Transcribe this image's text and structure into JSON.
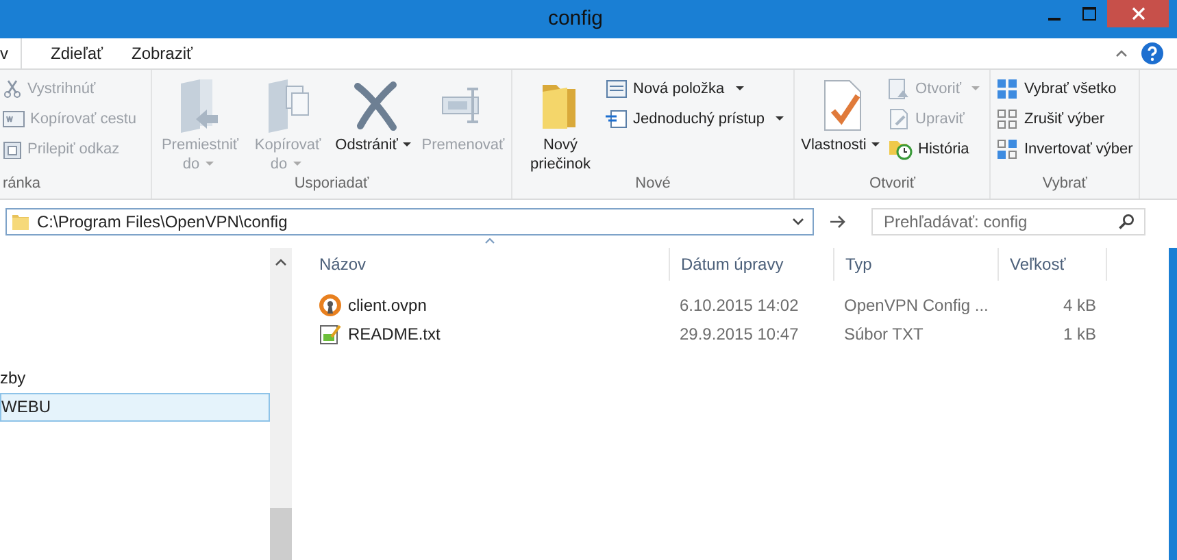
{
  "window": {
    "title": "config"
  },
  "tabs": [
    {
      "label": "v",
      "selected": true
    },
    {
      "label": "Zdieľať",
      "selected": false
    },
    {
      "label": "Zobraziť",
      "selected": false
    }
  ],
  "ribbon": {
    "groups": [
      {
        "label": "ránka",
        "items": [
          {
            "kind": "small",
            "label": "Vystrihnúť",
            "disabled": true,
            "dropdown": false
          },
          {
            "kind": "small",
            "label": "Kopírovať cestu",
            "disabled": true,
            "dropdown": false
          },
          {
            "kind": "small",
            "label": "Prilepiť odkaz",
            "disabled": true,
            "dropdown": false
          }
        ]
      },
      {
        "label": "Usporiadať",
        "items": [
          {
            "kind": "large",
            "label": "Premiestniť do",
            "disabled": true,
            "dropdown": true
          },
          {
            "kind": "large",
            "label": "Kopírovať do",
            "disabled": true,
            "dropdown": true
          },
          {
            "kind": "large",
            "label": "Odstrániť",
            "disabled": false,
            "dropdown": true
          },
          {
            "kind": "large",
            "label": "Premenovať",
            "disabled": true,
            "dropdown": false
          }
        ]
      },
      {
        "label": "Nové",
        "items": [
          {
            "kind": "large",
            "label": "Nový priečinok",
            "disabled": false,
            "dropdown": false
          },
          {
            "kind": "small",
            "label": "Nová položka",
            "disabled": false,
            "dropdown": true
          },
          {
            "kind": "small",
            "label": "Jednoduchý prístup",
            "disabled": false,
            "dropdown": true
          }
        ]
      },
      {
        "label": "Otvoriť",
        "items": [
          {
            "kind": "large",
            "label": "Vlastnosti",
            "disabled": false,
            "dropdown": true
          },
          {
            "kind": "small",
            "label": "Otvoriť",
            "disabled": true,
            "dropdown": true
          },
          {
            "kind": "small",
            "label": "Upraviť",
            "disabled": true,
            "dropdown": false
          },
          {
            "kind": "small",
            "label": "História",
            "disabled": false,
            "dropdown": false
          }
        ]
      },
      {
        "label": "Vybrať",
        "items": [
          {
            "kind": "small",
            "label": "Vybrať všetko",
            "disabled": false,
            "dropdown": false
          },
          {
            "kind": "small",
            "label": "Zrušiť výber",
            "disabled": false,
            "dropdown": false
          },
          {
            "kind": "small",
            "label": "Invertovať výber",
            "disabled": false,
            "dropdown": false
          }
        ]
      }
    ]
  },
  "address": {
    "value": "C:\\Program Files\\OpenVPN\\config"
  },
  "search": {
    "placeholder": "Prehľadávať: config"
  },
  "sidebar": {
    "items": [
      {
        "label": "zby",
        "selected": false
      },
      {
        "label": "WEBU",
        "selected": true
      }
    ]
  },
  "table": {
    "columns": [
      "Názov",
      "Dátum úpravy",
      "Typ",
      "Veľkosť"
    ],
    "rows": [
      {
        "kind": "ovpn",
        "cells": [
          "client.ovpn",
          "6.10.2015 14:02",
          "OpenVPN Config ...",
          "4 kB"
        ]
      },
      {
        "kind": "txt",
        "cells": [
          "README.txt",
          "29.9.2015 10:47",
          "Súbor TXT",
          "1 kB"
        ]
      }
    ]
  }
}
